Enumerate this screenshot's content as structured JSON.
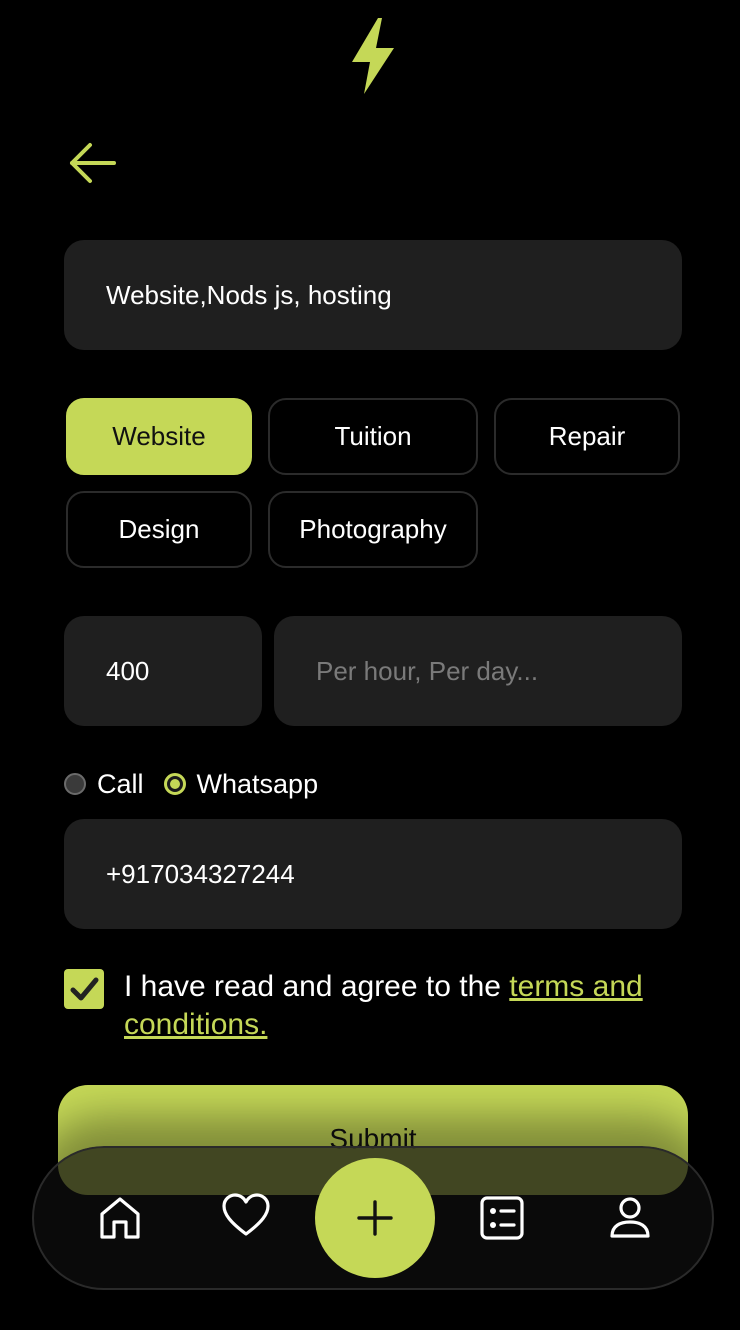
{
  "icons": {
    "logo": "lightning-bolt-icon",
    "back": "arrow-left-icon",
    "home": "home-icon",
    "favorites": "heart-icon",
    "add": "plus-icon",
    "list": "list-icon",
    "profile": "user-icon",
    "check": "checkmark-icon"
  },
  "colors": {
    "accent": "#c5d857",
    "background": "#000000",
    "field": "#1f1f1f"
  },
  "form": {
    "skills_value": "Website,Nods js, hosting",
    "categories": [
      "Website",
      "Tuition",
      "Repair",
      "Design",
      "Photography"
    ],
    "selected_category": "Website",
    "price_value": "400",
    "rate_unit_placeholder": "Per hour, Per day...",
    "contact_methods": [
      "Call",
      "Whatsapp"
    ],
    "selected_contact_method": "Whatsapp",
    "phone_value": "+917034327244",
    "terms_checked": true,
    "terms_text": "I have read and agree to the ",
    "terms_link": "terms and conditions.",
    "submit_label": "Submit"
  }
}
